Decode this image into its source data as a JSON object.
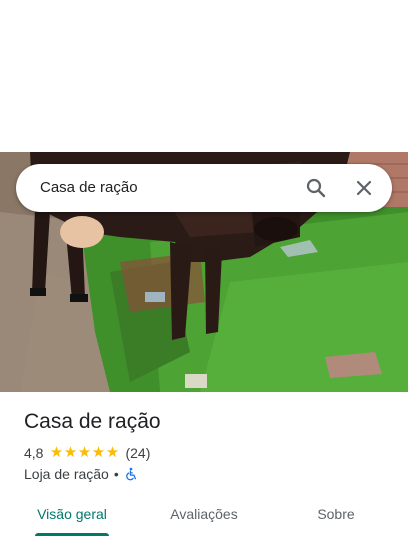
{
  "search": {
    "query": "Casa de ração"
  },
  "place": {
    "title": "Casa de ração",
    "rating": "4,8",
    "stars": [
      "★",
      "★",
      "★",
      "★",
      "★"
    ],
    "review_count": "(24)",
    "category": "Loja de ração",
    "separator": "•"
  },
  "tabs": [
    {
      "label": "Visão geral",
      "active": true
    },
    {
      "label": "Avaliações",
      "active": false
    },
    {
      "label": "Sobre",
      "active": false
    }
  ],
  "colors": {
    "accent": "#00796b",
    "star": "#fbbc04",
    "accessibility": "#1a73e8"
  },
  "icons": {
    "search": "search-icon",
    "close": "close-icon",
    "wheelchair": "wheelchair-accessible-icon"
  }
}
